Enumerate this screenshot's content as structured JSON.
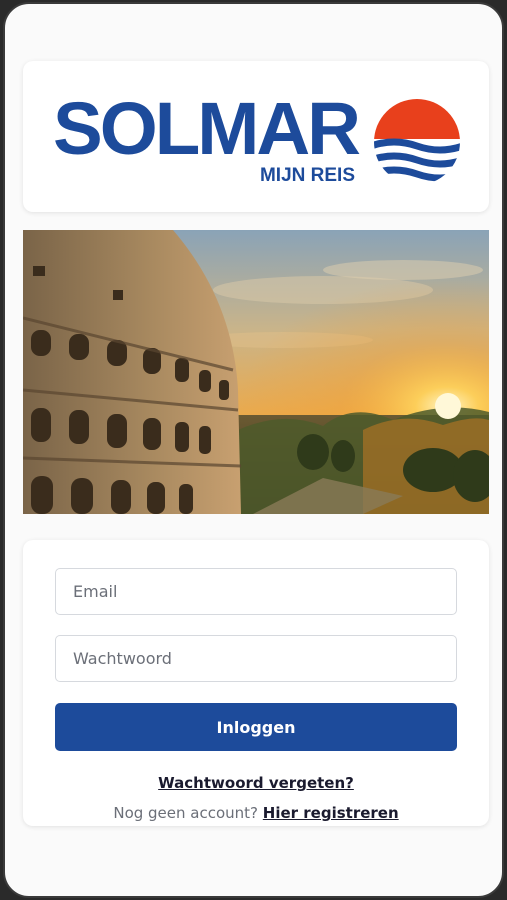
{
  "brand": {
    "name": "SOLMAR",
    "tagline": "MIJN REIS",
    "color_primary": "#1d4b9b",
    "color_sun": "#e8401c"
  },
  "hero": {
    "image": "colosseum-sunset-photo"
  },
  "login": {
    "email_placeholder": "Email",
    "password_placeholder": "Wachtwoord",
    "submit_label": "Inloggen",
    "forgot_label": "Wachtwoord vergeten?",
    "no_account_text": "Nog geen account?",
    "register_label": "Hier registreren"
  }
}
